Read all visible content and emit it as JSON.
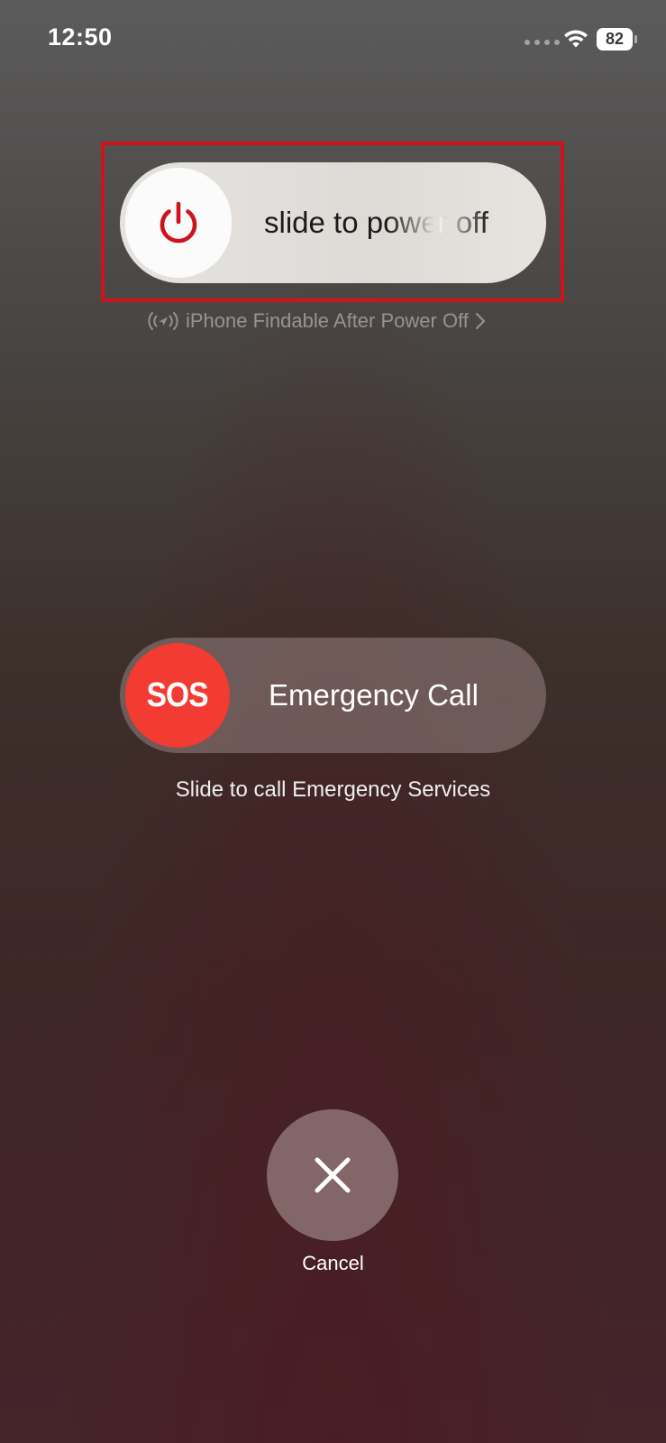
{
  "status_bar": {
    "time": "12:50",
    "battery_level": "82",
    "icons": [
      "signal-dots-icon",
      "wifi-icon",
      "battery-icon"
    ]
  },
  "power_off": {
    "label": "slide to power off",
    "icon": "power-icon",
    "icon_color": "#d0131b",
    "findable_text": "iPhone Findable After Power Off",
    "findable_icon": "location-broadcast-icon",
    "highlight_color": "#d0131b"
  },
  "emergency": {
    "knob_text": "SOS",
    "knob_color": "#f23b32",
    "label": "Emergency Call",
    "caption": "Slide to call Emergency Services"
  },
  "cancel": {
    "icon": "close-icon",
    "label": "Cancel"
  }
}
